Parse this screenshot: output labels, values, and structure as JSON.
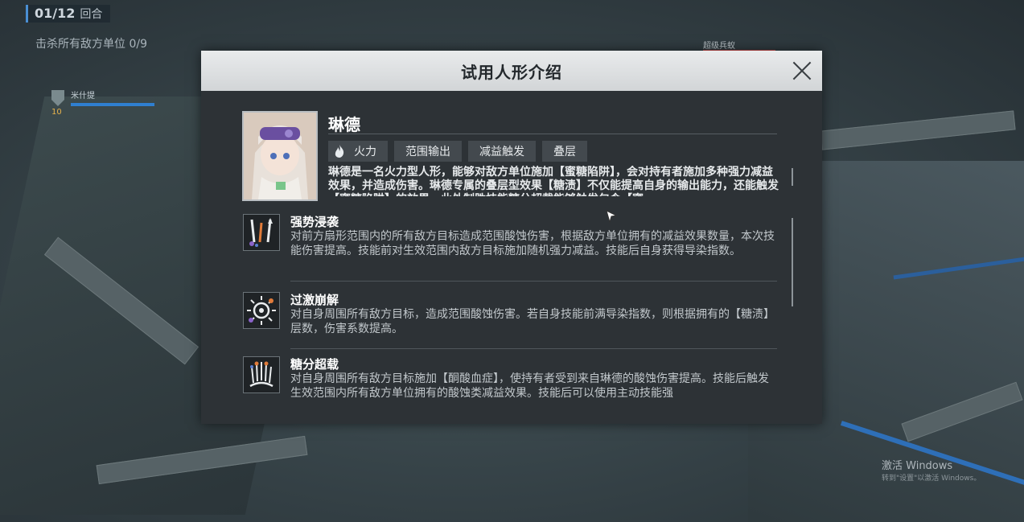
{
  "hud": {
    "round_current": "01/12",
    "round_suffix": "回合",
    "objective": "击杀所有敌方单位 0/9",
    "ally_name": "米什提",
    "ally_level": "10",
    "enemy_name": "超级兵蚁"
  },
  "modal": {
    "title": "试用人形介绍",
    "character": {
      "name": "琳德",
      "tags": [
        {
          "label": "火力",
          "icon": "flame-icon"
        },
        {
          "label": "范围输出"
        },
        {
          "label": "减益触发"
        },
        {
          "label": "叠层"
        }
      ],
      "description": "琳德是一名火力型人形，能够对敌方单位施加【蜜糖陷阱】，会对持有者施加多种强力减益效果，并造成伤害。琳德专属的叠层型效果【糖渍】不仅能提高自身的输出能力，还能触发【蜜糖陷阱】的效果，此外制胜技能糖分超载能够触发包含【蜜"
    },
    "skills": [
      {
        "name": "强势浸袭",
        "icon": "strike-skill-icon",
        "description": "对前方扇形范围内的所有敌方目标造成范围酸蚀伤害，根据敌方单位拥有的减益效果数量，本次技能伤害提高。技能前对生效范围内敌方目标施加随机强力减益。技能后自身获得导染指数。"
      },
      {
        "name": "过激崩解",
        "icon": "burst-skill-icon",
        "description": "对自身周围所有敌方目标，造成范围酸蚀伤害。若自身技能前满导染指数，则根据拥有的【糖渍】层数，伤害系数提高。"
      },
      {
        "name": "糖分超载",
        "icon": "overload-skill-icon",
        "description": "对自身周围所有敌方目标施加【酮酸血症】，使持有者受到来自琳德的酸蚀伤害提高。技能后触发生效范围内所有敌方单位拥有的酸蚀类减益效果。技能后可以使用主动技能强"
      }
    ]
  },
  "watermark": {
    "line1": "激活 Windows",
    "line2": "转到\"设置\"以激活 Windows。"
  },
  "colors": {
    "modal_bg": "#2d3236",
    "header_bg": "#e0e2e4",
    "tag_bg": "#43494e",
    "accent_blue": "#2f7fd0"
  }
}
